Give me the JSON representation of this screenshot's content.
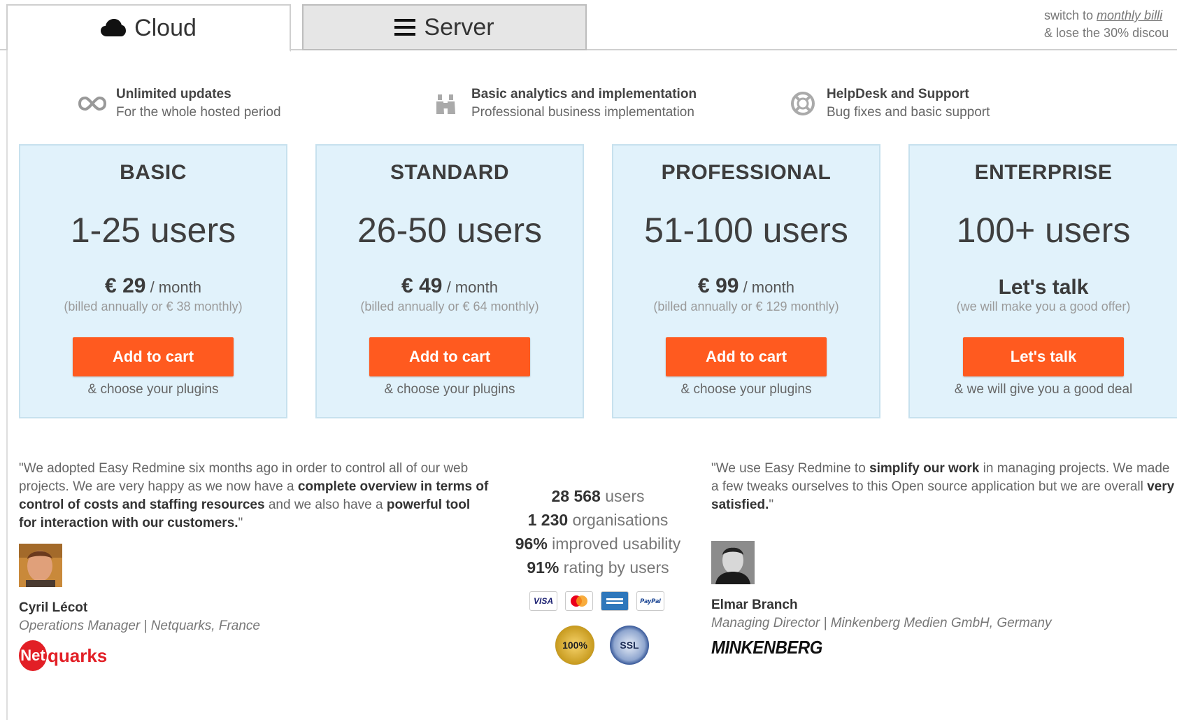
{
  "tabs": [
    {
      "label": "Cloud",
      "icon": "cloud-icon",
      "active": true
    },
    {
      "label": "Server",
      "icon": "menu-icon",
      "active": false
    }
  ],
  "billing_switch": {
    "prefix": "switch to ",
    "link": "monthly billi",
    "line2": "& lose the 30% discou"
  },
  "features": [
    {
      "icon": "infinity-icon",
      "title": "Unlimited updates",
      "subtitle": "For the whole hosted period"
    },
    {
      "icon": "binoculars-icon",
      "title": "Basic analytics and implementation",
      "subtitle": "Professional business implementation"
    },
    {
      "icon": "lifebuoy-icon",
      "title": "HelpDesk and Support",
      "subtitle": "Bug fixes and basic support"
    }
  ],
  "plans": [
    {
      "name": "BASIC",
      "users": "1-25 users",
      "price": "€ 29",
      "period": "/ month",
      "billed": "(billed annually or € 38 monthly)",
      "cta": "Add to cart",
      "note": "& choose your plugins"
    },
    {
      "name": "STANDARD",
      "users": "26-50 users",
      "price": "€ 49",
      "period": "/ month",
      "billed": "(billed annually or € 64 monthly)",
      "cta": "Add to cart",
      "note": "& choose your plugins"
    },
    {
      "name": "PROFESSIONAL",
      "users": "51-100 users",
      "price": "€ 99",
      "period": "/ month",
      "billed": "(billed annually or € 129 monthly)",
      "cta": "Add to cart",
      "note": "& choose your plugins"
    },
    {
      "name": "ENTERPRISE",
      "users": "100+ users",
      "price": "Let's talk",
      "billed": "(we will make you a good offer)",
      "cta": "Let's talk",
      "note": "& we will give you a good deal"
    }
  ],
  "testimonial_left": {
    "q1": "\"We adopted Easy Redmine six months ago in order to control all of our web projects. We are very happy as we now have a ",
    "b1": "complete overview in terms of control of costs and staffing resources",
    "q2": " and we also have a ",
    "b2": "powerful tool for interaction with our customers.",
    "q3": "\"",
    "name": "Cyril Lécot",
    "role": "Operations Manager | Netquarks, France",
    "logo_a": "Net",
    "logo_b": "quarks"
  },
  "testimonial_right": {
    "q1": "\"We use Easy Redmine to ",
    "b1": "simplify our work",
    "q2": " in managing projects. We made a few tweaks ourselves to this Open source application but we are overall ",
    "b2": "very satisfied.",
    "q3": "\"",
    "name": "Elmar Branch",
    "role": "Managing Director | Minkenberg Medien GmbH, Germany",
    "logo": "MINKENBERG"
  },
  "stats": [
    {
      "value": "28 568",
      "label": " users"
    },
    {
      "value": "1 230",
      "label": " organisations"
    },
    {
      "value": "96%",
      "label": " improved usability"
    },
    {
      "value": "91%",
      "label": " rating by users"
    }
  ],
  "payments": [
    "VISA",
    "",
    "",
    "PayPal"
  ],
  "seals": [
    "100%",
    "SSL"
  ],
  "colors": {
    "cta": "#ff5a1f",
    "card_bg": "#e1f2fb",
    "tab_inactive": "#e6e6e6"
  }
}
